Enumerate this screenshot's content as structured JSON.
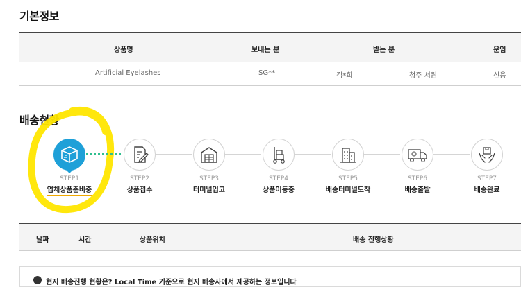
{
  "sections": {
    "basic_info_title": "기본정보",
    "delivery_status_title": "배송현황"
  },
  "info_table": {
    "headers": {
      "product": "상품명",
      "sender": "보내는 분",
      "receiver": "받는 분",
      "fare": "운임"
    },
    "row": {
      "product": "Artificial Eyelashes",
      "sender": "SG**",
      "receiver_name": "김*희",
      "receiver_location": "청주 서원",
      "fare": "신용"
    }
  },
  "steps": [
    {
      "num": "STEP1",
      "label": "업체상품준비중",
      "icon": "box-icon",
      "active": true
    },
    {
      "num": "STEP2",
      "label": "상품접수",
      "icon": "document-pen-icon",
      "active": false
    },
    {
      "num": "STEP3",
      "label": "터미널입고",
      "icon": "warehouse-icon",
      "active": false
    },
    {
      "num": "STEP4",
      "label": "상품이동중",
      "icon": "hand-truck-icon",
      "active": false
    },
    {
      "num": "STEP5",
      "label": "배송터미널도착",
      "icon": "building-icon",
      "active": false
    },
    {
      "num": "STEP6",
      "label": "배송출발",
      "icon": "delivery-truck-icon",
      "active": false
    },
    {
      "num": "STEP7",
      "label": "배송완료",
      "icon": "hands-box-icon",
      "active": false
    }
  ],
  "tracking_table": {
    "headers": {
      "date": "날짜",
      "time": "시간",
      "location": "상품위치",
      "progress": "배송 진행상황"
    }
  },
  "notice": {
    "text": "현지 배송진행 현황은? Local Time 기준으로 현지 배송사에서 제공하는 정보입니다"
  },
  "colors": {
    "active_step": "#1ea0d8",
    "highlight": "#ffe600",
    "dotted_connector": "#2fbf8f"
  }
}
